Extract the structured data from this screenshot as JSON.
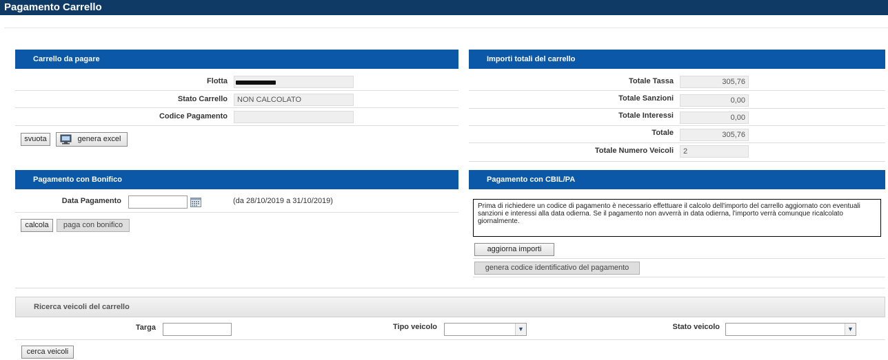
{
  "page": {
    "title": "Pagamento Carrello"
  },
  "carrello": {
    "header": "Carrello da pagare",
    "flotta_label": "Flotta",
    "stato_label": "Stato Carrello",
    "stato_value": "NON CALCOLATO",
    "codice_label": "Codice Pagamento",
    "codice_value": "",
    "svuota_label": "svuota",
    "excel_label": "genera excel"
  },
  "importi": {
    "header": "Importi totali del carrello",
    "rows": [
      {
        "label": "Totale Tassa",
        "value": "305,76"
      },
      {
        "label": "Totale Sanzioni",
        "value": "0,00"
      },
      {
        "label": "Totale Interessi",
        "value": "0,00"
      },
      {
        "label": "Totale",
        "value": "305,76"
      },
      {
        "label": "Totale Numero Veicoli",
        "value": "2"
      }
    ]
  },
  "bonifico": {
    "header": "Pagamento con Bonifico",
    "data_label": "Data Pagamento",
    "data_value": "",
    "range_text": "(da 28/10/2019 a 31/10/2019)",
    "calcola_label": "calcola",
    "paga_label": "paga con bonifico"
  },
  "cbill": {
    "header": "Pagamento con CBIL/PA",
    "notice": "Prima di richiedere un codice di pagamento è necessario effettuare il calcolo dell'importo del carrello aggiornato con eventuali sanzioni e interessi alla data odierna. Se il pagamento non avverrà in data odierna, l'importo verrà comunque ricalcolato giornalmente.",
    "aggiorna_label": "aggiorna importi",
    "genera_label": "genera codice identificativo del pagamento"
  },
  "ricerca": {
    "header": "Ricerca veicoli del carrello",
    "targa_label": "Targa",
    "targa_value": "",
    "tipo_label": "Tipo veicolo",
    "tipo_value": "",
    "stato_label": "Stato veicolo",
    "stato_value": "",
    "cerca_label": "cerca veicoli"
  },
  "icons": {
    "excel": "monitor-icon",
    "calendar": "calendar-icon",
    "dropdown": "chevron-down-icon"
  }
}
